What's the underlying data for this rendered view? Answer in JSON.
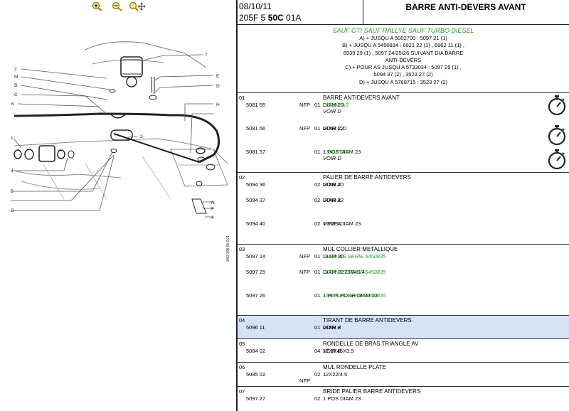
{
  "toolbar": {
    "zoom_in_icon": "zoom-in-icon",
    "zoom_out_icon": "zoom-out-icon",
    "pan_icon": "zoom-pan-icon"
  },
  "drawing_labels": {
    "n7": "7",
    "n2": "2",
    "nM": "M",
    "nB": "B",
    "nC": "C",
    "nK": "K",
    "nE": "E",
    "nD": "D",
    "nH": "H",
    "n3": "3",
    "nL": "L",
    "nJ": "J",
    "n5": "5",
    "nG": "G",
    "nN": "N",
    "nF": "F",
    "n4": "4",
    "plate_code": "3/93 205 50 C01"
  },
  "header": {
    "date": "08/10/11",
    "code_prefix": "205F 5 ",
    "code_bold": "50C",
    "code_suffix": " 01A",
    "title": "BARRE ANTI-DEVERS AVANT"
  },
  "notes": {
    "head": "SAUF GTI SAUF RALLYE SAUF TURBO DIESEL",
    "lines": [
      "A) + JUSQU A 5002700 : 5097 21 (1)",
      "B) + JUSQU A 5450834 : 6921 22 (1) , 6962 11 (1) ,",
      "6939 29 (1) , 5097 24/25/26 SUIVANT DIA BARRE",
      "ANTI-DEVERS",
      "C) + POUR AS JUSQU A 5733034 : 5097 25 (1) ,",
      "5094 37 (2) , 3523 27 (2)",
      "D) + JUSQU A 5768715 : 3523 27 (2)"
    ]
  },
  "sections": [
    {
      "no": "01",
      "title": "BARRE ANTIDEVERS AVANT",
      "rows": [
        {
          "ref": "5081 55",
          "nfp": "NFP",
          "qty": "01",
          "desc": "DIAM 20",
          "notes": [
            {
              "text": "- SAUF AS",
              "green": true
            },
            {
              "text": "VOIR D",
              "green": false
            }
          ]
        },
        {
          "ref": "5081 56",
          "nfp": "NFP",
          "qty": "01",
          "desc": "DIAM 22",
          "notes": [
            {
              "text": "VOIR C,D",
              "green": false
            }
          ]
        },
        {
          "ref": "5081 57",
          "nfp": "",
          "qty": "01",
          "desc": "1 POS DIAM 23",
          "notes": [
            {
              "text": "- SAUF AS",
              "green": true
            },
            {
              "text": "VOIR D",
              "green": false
            }
          ]
        }
      ]
    },
    {
      "no": "02",
      "title": "PALIER DE BARRE ANTIDEVERS",
      "rows": [
        {
          "ref": "5094 36",
          "nfp": "",
          "qty": "02",
          "desc": "DIAM 20",
          "notes": [
            {
              "text": "VOIR A",
              "green": false
            }
          ]
        },
        {
          "ref": "5094 37",
          "nfp": "",
          "qty": "02",
          "desc": "DIAM 22",
          "notes": [
            {
              "text": "VOIR A",
              "green": false
            }
          ]
        },
        {
          "ref": "5094 40",
          "nfp": "",
          "qty": "02",
          "desc": "1 POS DIAM 23",
          "notes": [
            {
              "text": "VOIR A",
              "green": false
            }
          ]
        }
      ]
    },
    {
      "no": "03",
      "title": "MUL COLLIER METALLIQUE",
      "rows": [
        {
          "ref": "5097 24",
          "nfp": "NFP",
          "qty": "01",
          "desc": "DIAM 20",
          "notes": [
            {
              "text": "- DEPUIS SERIE 5450835",
              "green": true
            }
          ]
        },
        {
          "ref": "5097 25",
          "nfp": "NFP",
          "qty": "01",
          "desc": "DIAM 22 EPAIS 4",
          "notes": [
            {
              "text": "- DEPUIS SERIE 5450835",
              "green": true
            }
          ]
        },
        {
          "ref": "5097 26",
          "nfp": "",
          "qty": "01",
          "desc": "1 POS POUR DIAM 23",
          "notes": [
            {
              "text": "- DEPUIS SERIE 5450835",
              "green": true
            }
          ]
        }
      ]
    },
    {
      "no": "04",
      "title": "TIRANT DE BARRE ANTIDEVERS",
      "rows": [
        {
          "ref": "5096 11",
          "nfp": "",
          "qty": "01",
          "desc": "DIAM 7",
          "notes": [
            {
              "text": "VOIR B",
              "green": false
            }
          ]
        }
      ]
    },
    {
      "no": "05",
      "title": "RONDELLE DE BRAS TRIANGLE AV",
      "rows": [
        {
          "ref": "5084 02",
          "nfp": "",
          "qty": "04",
          "desc": "12.2X45X3.5",
          "notes": [
            {
              "text": "VOIR B",
              "green": false
            }
          ]
        }
      ]
    },
    {
      "no": "06",
      "title": "MUL RONDELLE PLATE",
      "rows": [
        {
          "ref": "5085 02",
          "nfp": "NFP",
          "qty": "02",
          "desc": "12X22/4.5",
          "notes": []
        }
      ]
    },
    {
      "no": "07",
      "title": "BRIDE PALIER BARRE ANTIDEVERS",
      "rows": [
        {
          "ref": "5097 27",
          "nfp": "",
          "qty": "02",
          "desc": "1 POS DIAM 23",
          "notes": []
        }
      ]
    }
  ],
  "timers": [
    "stopwatch-icon",
    "stopwatch-icon",
    "stopwatch-icon"
  ],
  "colors": {
    "note_green": "#2a9a2a",
    "highlight": "#d6e2f6",
    "toolbar_icon": "#b08a00"
  }
}
